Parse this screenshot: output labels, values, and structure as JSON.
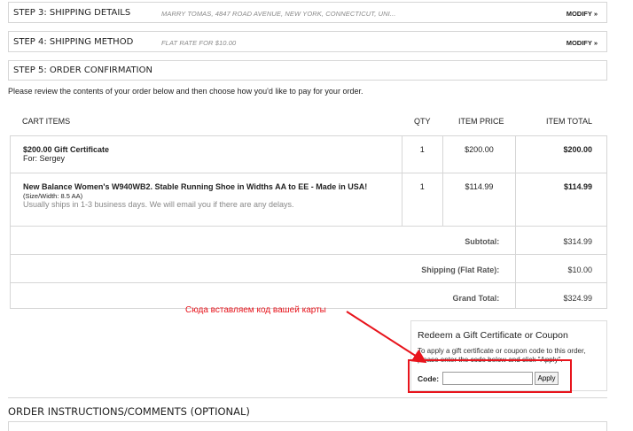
{
  "steps": [
    {
      "title": "STEP 3: SHIPPING DETAILS",
      "info": "MARRY TOMAS, 4847 ROAD AVENUE, NEW YORK, CONNECTICUT, UNI...",
      "modify": "MODIFY »"
    },
    {
      "title": "STEP 4: SHIPPING METHOD",
      "info": "FLAT RATE FOR $10.00",
      "modify": "MODIFY »"
    },
    {
      "title": "STEP 5: ORDER CONFIRMATION"
    }
  ],
  "intro": "Please review the contents of your order below and then choose how you'd like to pay for your order.",
  "cart": {
    "headers": {
      "items": "CART ITEMS",
      "qty": "QTY",
      "price": "ITEM PRICE",
      "total": "ITEM TOTAL"
    },
    "rows": [
      {
        "name": "$200.00 Gift Certificate",
        "sub": "For: Sergey",
        "qty": "1",
        "price": "$200.00",
        "total": "$200.00"
      },
      {
        "name": "New Balance Women's W940WB2. Stable Running Shoe in Widths AA to EE - Made in USA!",
        "size": "(Size/Width: 8.5 AA)",
        "ship": "Usually ships in 1-3 business days. We will email you if there are any delays.",
        "qty": "1",
        "price": "$114.99",
        "total": "$114.99"
      }
    ],
    "summary": [
      {
        "label": "Subtotal:",
        "value": "$314.99"
      },
      {
        "label": "Shipping (Flat Rate):",
        "value": "$10.00"
      },
      {
        "label": "Grand Total:",
        "value": "$324.99"
      }
    ]
  },
  "annotation": "Сюда вставляем код вашей карты",
  "annotation_color": "#e8141c",
  "coupon": {
    "title": "Redeem a Gift Certificate or Coupon",
    "description": "To apply a gift certificate or coupon code to this order, please enter the code below and click \"Apply\".",
    "code_label": "Code:",
    "code_value": "",
    "apply_label": "Apply"
  },
  "order_instructions": {
    "title": "ORDER INSTRUCTIONS/COMMENTS (OPTIONAL)"
  }
}
